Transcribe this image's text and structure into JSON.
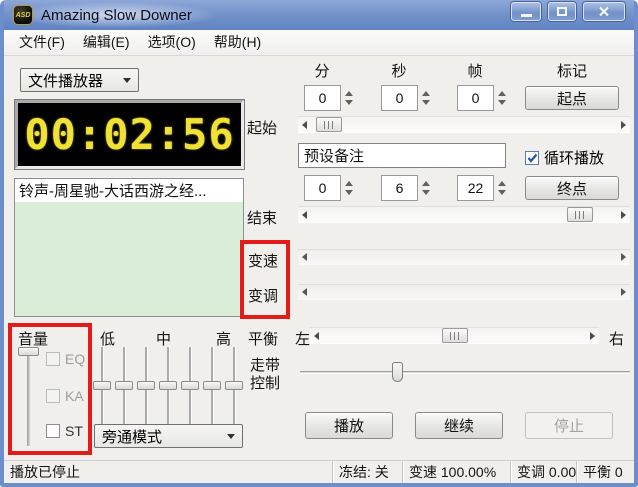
{
  "window": {
    "title": "Amazing Slow Downer",
    "icon_label": "ASD"
  },
  "menu": {
    "items": [
      {
        "label": "文件(F)"
      },
      {
        "label": "编辑(E)"
      },
      {
        "label": "选项(O)"
      },
      {
        "label": "帮助(H)"
      }
    ]
  },
  "player": {
    "source_select": "文件播放器",
    "time_display": "00:02:56",
    "playlist": [
      {
        "title": "铃声-周星驰-大话西游之经..."
      }
    ]
  },
  "markers": {
    "columns": {
      "min": "分",
      "sec": "秒",
      "frame": "帧",
      "mark": "标记"
    },
    "start_row": {
      "min": "0",
      "sec": "0",
      "frame": "0",
      "button": "起点"
    },
    "end_row": {
      "min": "0",
      "sec": "6",
      "frame": "22",
      "button": "终点"
    },
    "start_slider_label": "起始",
    "end_slider_label": "结束",
    "preset_note": "预设备注",
    "loop_label": "循环播放",
    "loop_checked": true
  },
  "effects": {
    "speed_label": "变速",
    "pitch_label": "变调"
  },
  "mixer": {
    "volume_label": "音量",
    "eq_label": "EQ",
    "ka_label": "KA",
    "st_label": "ST",
    "band_low": "低",
    "band_mid": "中",
    "band_high": "高",
    "bypass_mode": "旁通模式"
  },
  "balance": {
    "label": "平衡",
    "left_label": "左",
    "right_label": "右"
  },
  "transport": {
    "label_line1": "走带",
    "label_line2": "控制",
    "play": "播放",
    "resume": "继续",
    "stop": "停止"
  },
  "statusbar": {
    "state": "播放已停止",
    "freeze": "冻结: 关",
    "speed": "变速 100.00%",
    "pitch": "变调 0.00",
    "balance": "平衡 0"
  },
  "colors": {
    "highlight_red": "#e31b1b",
    "lcd_yellow": "#f2e135",
    "playlist_green": "#d9edd9",
    "titlebar_blue": "#7493cb"
  }
}
